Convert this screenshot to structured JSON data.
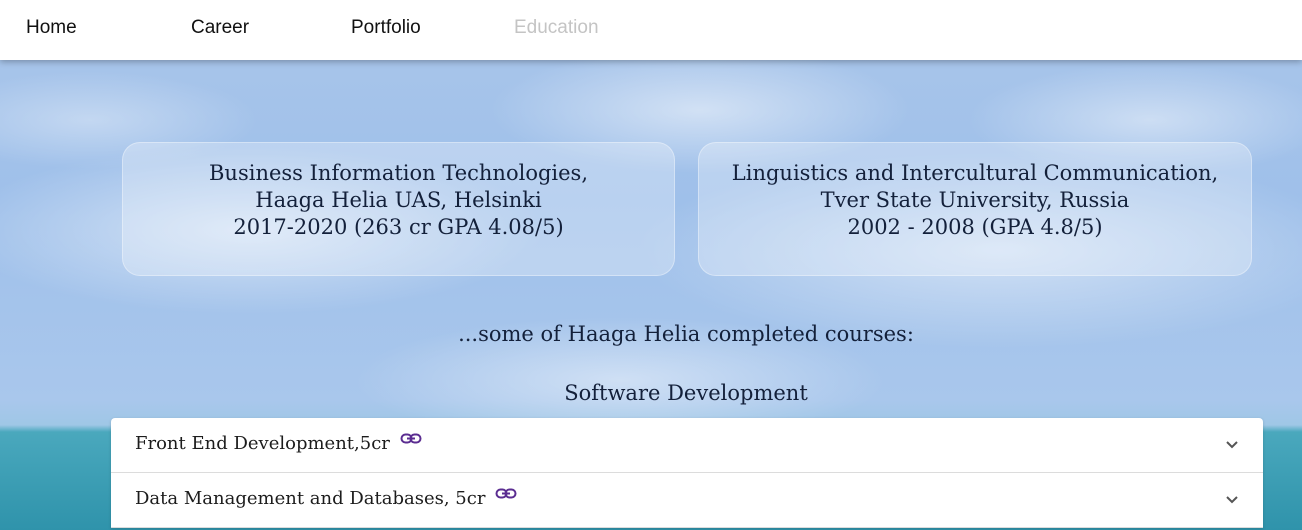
{
  "nav": {
    "items": [
      {
        "label": "Home",
        "active": false
      },
      {
        "label": "Career",
        "active": false
      },
      {
        "label": "Portfolio",
        "active": false
      },
      {
        "label": "Education",
        "active": true
      }
    ]
  },
  "education": [
    {
      "lines": [
        "Business Information Technologies,",
        "Haaga Helia UAS, Helsinki",
        "2017-2020 (263 cr GPA 4.08/5)"
      ]
    },
    {
      "lines": [
        "Linguistics and Intercultural Communication,",
        "Tver State University, Russia",
        "2002 - 2008 (GPA 4.8/5)"
      ]
    }
  ],
  "courses": {
    "intro": "...some of Haaga Helia completed courses:",
    "section_title": "Software Development",
    "items": [
      {
        "label": "Front End Development,5cr",
        "icon": "link-icon",
        "expand_icon": "chevron-down-icon"
      },
      {
        "label": "Data Management and Databases, 5cr",
        "icon": "link-icon",
        "expand_icon": "chevron-down-icon"
      }
    ]
  },
  "colors": {
    "link_icon": "#5b2d91",
    "nav_active": "#c4c4c4",
    "text": "#13203a"
  }
}
